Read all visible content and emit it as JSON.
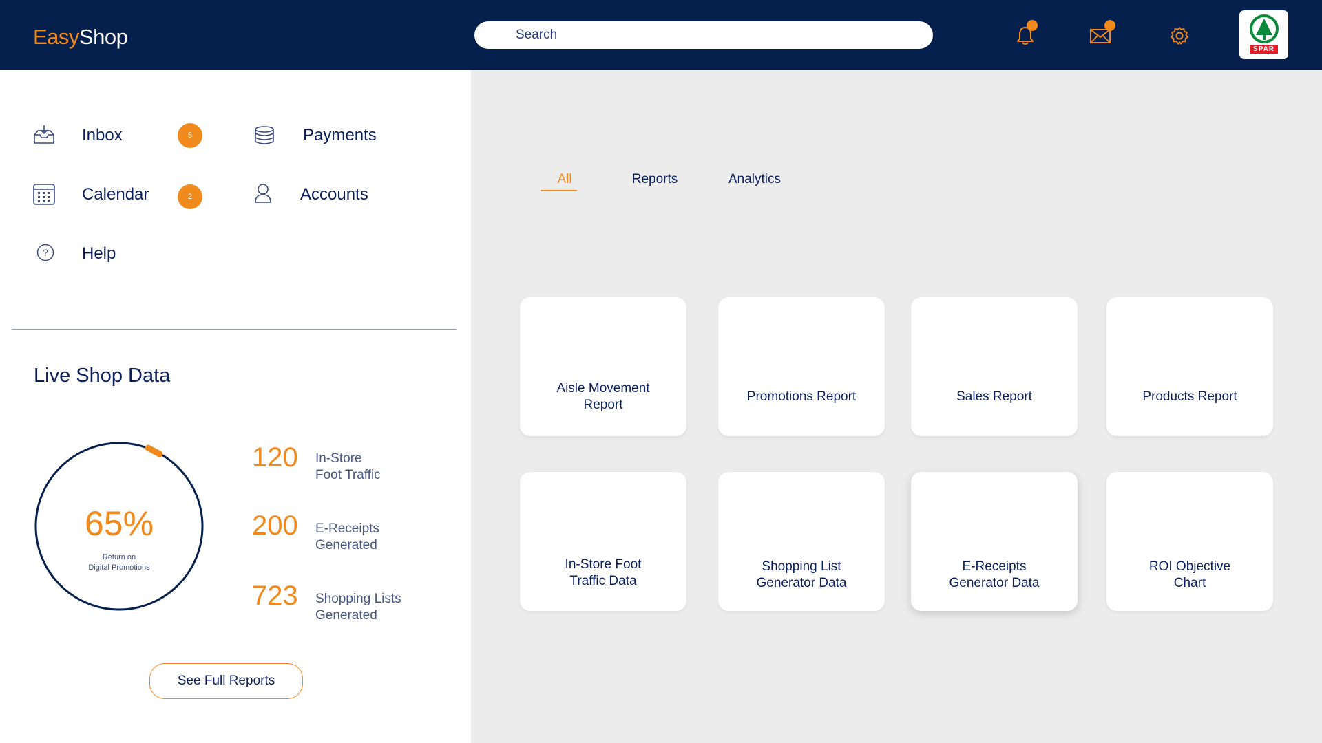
{
  "app": {
    "logo_easy": "Easy",
    "logo_shop": "Shop"
  },
  "search": {
    "placeholder": "Search"
  },
  "header_icons": [
    "bell-icon",
    "mail-icon",
    "gear-icon"
  ],
  "brand": {
    "name": "SPAR"
  },
  "nav": {
    "inbox": {
      "label": "Inbox",
      "badge": "5"
    },
    "payments": {
      "label": "Payments"
    },
    "calendar": {
      "label": "Calendar",
      "badge": "2"
    },
    "accounts": {
      "label": "Accounts"
    },
    "help": {
      "label": "Help"
    }
  },
  "live": {
    "title": "Live Shop Data",
    "gauge": {
      "value": "65%",
      "caption_line1": "Return on",
      "caption_line2": "Digital Promotions"
    },
    "stats": [
      {
        "value": "120",
        "label_line1": "In-Store",
        "label_line2": "Foot Traffic"
      },
      {
        "value": "200",
        "label_line1": "E-Receipts",
        "label_line2": "Generated"
      },
      {
        "value": "723",
        "label_line1": "Shopping Lists",
        "label_line2": "Generated"
      }
    ],
    "button": "See Full Reports"
  },
  "tabs": [
    {
      "label": "All",
      "active": true
    },
    {
      "label": "Reports"
    },
    {
      "label": "Analytics"
    }
  ],
  "cards": [
    {
      "line1": "Aisle Movement",
      "line2": "Report"
    },
    {
      "line1": "Promotions Report",
      "line2": ""
    },
    {
      "line1": "Sales Report",
      "line2": ""
    },
    {
      "line1": "Products Report",
      "line2": ""
    },
    {
      "line1": "In-Store Foot",
      "line2": "Traffic Data"
    },
    {
      "line1": "Shopping List",
      "line2": "Generator Data"
    },
    {
      "line1": "E-Receipts",
      "line2": "Generator Data"
    },
    {
      "line1": "ROI Objective",
      "line2": "Chart"
    }
  ],
  "colors": {
    "navy": "#06204d",
    "accent": "#f18a1d",
    "text": "#0b1f5c",
    "bg_right": "#ececec",
    "brand_green": "#0a8a3a",
    "brand_red": "#e31e25"
  }
}
